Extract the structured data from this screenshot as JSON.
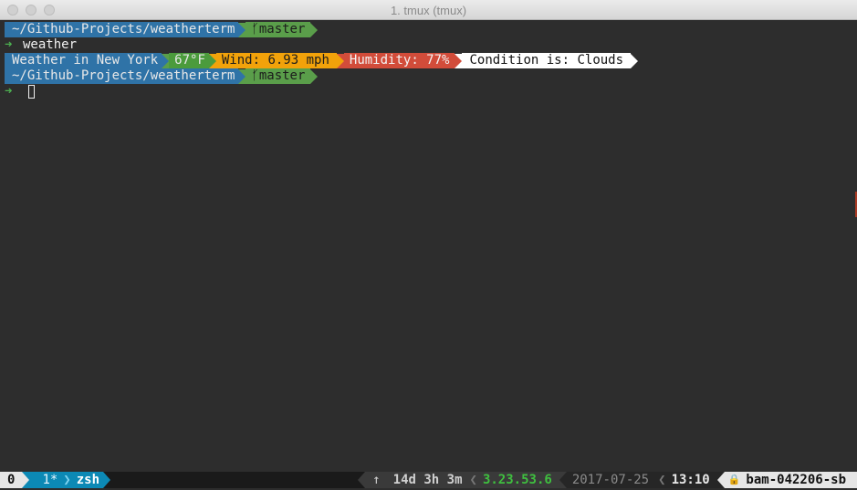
{
  "window": {
    "title": "1. tmux (tmux)"
  },
  "terminal": {
    "line1": {
      "path": "~/Github-Projects/weatherterm",
      "branch_icon": "ᚶ",
      "branch": "master"
    },
    "line2": {
      "prompt_icon": "➜",
      "command": "weather"
    },
    "weather": {
      "location": "Weather in New York",
      "temp": "67°F",
      "wind": "Wind: 6.93 mph",
      "humidity": "Humidity: 77%",
      "condition": "Condition is: Clouds"
    },
    "line4": {
      "path": "~/Github-Projects/weatherterm",
      "branch_icon": "ᚶ",
      "branch": "master"
    },
    "line5": {
      "prompt_icon": "➜"
    }
  },
  "statusbar": {
    "session": "0",
    "window_index": "1*",
    "window_name": "zsh",
    "uptime_icon": "↑",
    "uptime": "14d 3h 3m",
    "load": [
      "3.2",
      "3.5",
      "3.6"
    ],
    "date": "2017-07-25",
    "time": "13:10",
    "lock_icon": "🔒",
    "host": "bam-042206-sb"
  },
  "colors": {
    "blue": "#2f73a7",
    "green": "#5a9e4a",
    "orange": "#f2a20a",
    "red": "#d24c3a",
    "white": "#ffffff",
    "status_teal": "#0c89b5"
  }
}
